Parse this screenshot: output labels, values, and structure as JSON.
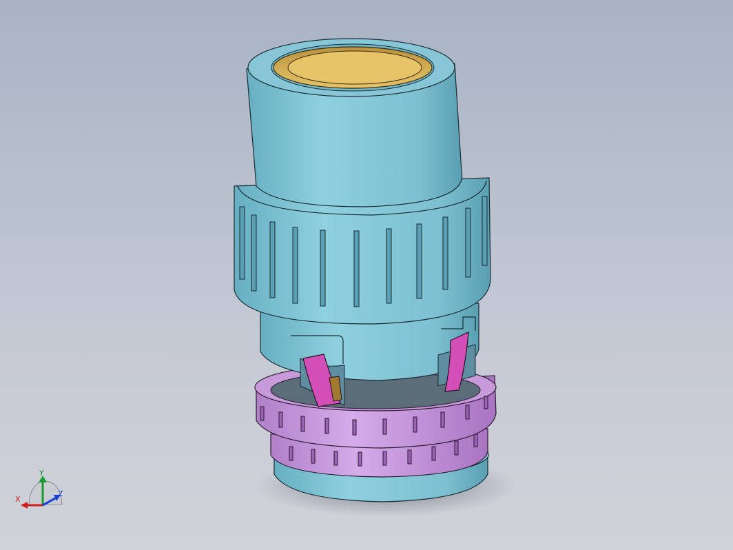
{
  "viewport": {
    "background_top": "#a9b3c5",
    "background_bottom": "#d0d3d9"
  },
  "model": {
    "body_color": "#7ec3d4",
    "body_shade": "#5a9fb3",
    "insert_color": "#d9b65c",
    "ring_color": "#c496d9",
    "clip_color": "#d24fb8"
  },
  "triad": {
    "x_label": "X",
    "y_label": "Y",
    "z_label": "Z",
    "x_color": "#d11b1b",
    "y_color": "#1a9a2e",
    "z_color": "#1c3fd6"
  }
}
